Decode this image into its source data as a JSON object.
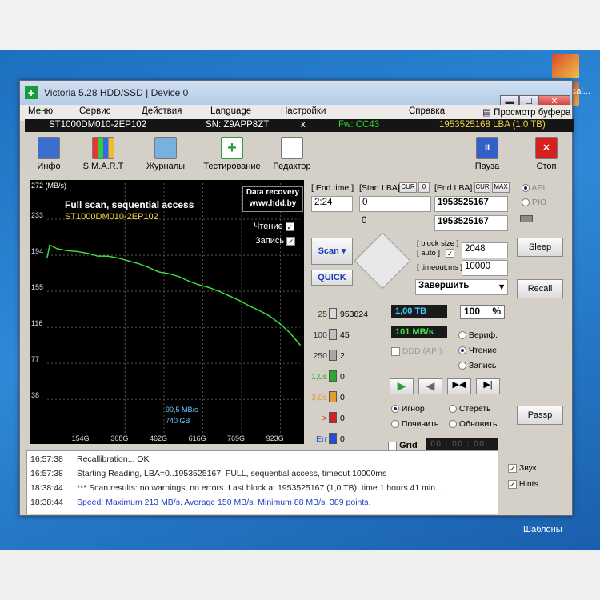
{
  "window": {
    "title": "Victoria 5.28 HDD/SSD | Device 0",
    "minimize": "▬",
    "maximize": "☐",
    "close": "✕"
  },
  "menu": [
    "Меню",
    "Сервис",
    "Действия",
    "Language",
    "Настройки",
    "Справка"
  ],
  "buffer_label": "Просмотр буфера",
  "device": {
    "model": "ST1000DM010-2EP102",
    "sn": "SN: Z9APP8ZT",
    "close_x": "x",
    "fw": "Fw: CC43",
    "lba": "1953525168 LBA (1,0 TB)"
  },
  "toolbar": {
    "info": "Инфо",
    "smart": "S.M.A.R.T",
    "logs": "Журналы",
    "test": "Тестирование",
    "editor": "Редактор",
    "pause": "Пауза",
    "stop": "Стоп"
  },
  "graph": {
    "title": "Full scan, sequential access",
    "model": "ST1000DM010-2EP102",
    "data_recovery_line1": "Data recovery",
    "data_recovery_line2": "www.hdd.by",
    "read_label": "Чтение",
    "write_label": "Запись",
    "speed_now": "90,5 MB/s",
    "pos_now": "740 GB"
  },
  "chart_data": {
    "type": "line",
    "ylabel": "272 (MB/s)",
    "y_ticks": [
      "233",
      "194",
      "155",
      "116",
      "77",
      "38"
    ],
    "x_ticks": [
      "154G",
      "308G",
      "462G",
      "616G",
      "769G",
      "923G"
    ],
    "ylim": [
      0,
      272
    ],
    "xlim": [
      0,
      1000
    ],
    "series": [
      {
        "x": [
          0,
          10,
          40,
          80,
          120,
          160,
          200,
          240,
          280,
          320,
          360,
          400,
          440,
          480,
          520,
          560,
          600,
          640,
          680,
          720,
          760,
          800,
          840,
          880,
          920,
          960,
          1000
        ],
        "values": [
          192,
          205,
          201,
          199,
          198,
          196,
          193,
          193,
          191,
          188,
          185,
          181,
          176,
          174,
          171,
          166,
          162,
          159,
          155,
          150,
          145,
          139,
          134,
          128,
          120,
          110,
          97
        ]
      }
    ]
  },
  "controls": {
    "end_time_label": "[ End time ]",
    "end_time": "2:24",
    "start_lba_label": "[Start LBA]",
    "cur": "CUR",
    "zero": "0",
    "end_lba_label": "[End LBA]",
    "max": "MAX",
    "start_lba": "0",
    "end_lba": "1953525167",
    "cur_lba": "0",
    "cur_lba_end": "1953525167",
    "block_size_label": "[ block size ]",
    "auto_label": "[ auto ]",
    "block_size": "2048",
    "timeout_label": "[ timeout,ms ]",
    "timeout": "10000",
    "scan": "Scan",
    "quick": "QUICK",
    "finish": "Завершить"
  },
  "blocks": [
    {
      "ms": "25",
      "count": "953824",
      "color": "#d8d8d8"
    },
    {
      "ms": "100",
      "count": "45",
      "color": "#c0c0c0"
    },
    {
      "ms": "250",
      "count": "2",
      "color": "#a8a8a8"
    },
    {
      "ms": "1,0s",
      "count": "0",
      "color": "#2ea82e"
    },
    {
      "ms": "3,0s",
      "count": "0",
      "color": "#e59a2a"
    },
    {
      "ms": ">",
      "count": "0",
      "color": "#d32020"
    },
    {
      "ms": "Err",
      "count": "0",
      "color": "#1f4fd6"
    }
  ],
  "stats": {
    "processed": "1,00 TB",
    "percent": "100",
    "pct_sign": "%",
    "speed": "101 MB/s",
    "ddd": "DDD (API)",
    "verify": "Вериф.",
    "read": "Чтение",
    "write": "Запись"
  },
  "actions": {
    "ignore": "Игнор",
    "erase": "Стереть",
    "repair": "Починить",
    "refresh": "Обновить",
    "grid": "Grid",
    "timer": "00 : 00 : 00"
  },
  "side": {
    "api": "API",
    "pio": "PIO",
    "sleep": "Sleep",
    "recall": "Recall",
    "passp": "Passp"
  },
  "log": [
    {
      "time": "16:57:38",
      "text": "Recallibration... OK",
      "color": "#222"
    },
    {
      "time": "16:57:38",
      "text": "Starting Reading, LBA=0..1953525167, FULL, sequential access, timeout 10000ms",
      "color": "#222"
    },
    {
      "time": "18:38:44",
      "text": "*** Scan results: no warnings, no errors. Last block at 1953525167 (1,0 TB), time 1 hours 41 min...",
      "color": "#222"
    },
    {
      "time": "18:38:44",
      "text": "Speed: Maximum 213 MB/s. Average 150 MB/s. Minimum 88 MB/s. 389 points.",
      "color": "#1c3fbf"
    }
  ],
  "log_opts": {
    "sound": "Звук",
    "hints": "Hints"
  },
  "desktop": {
    "label1": "Шаблоны",
    "label2": "Fcal..."
  }
}
